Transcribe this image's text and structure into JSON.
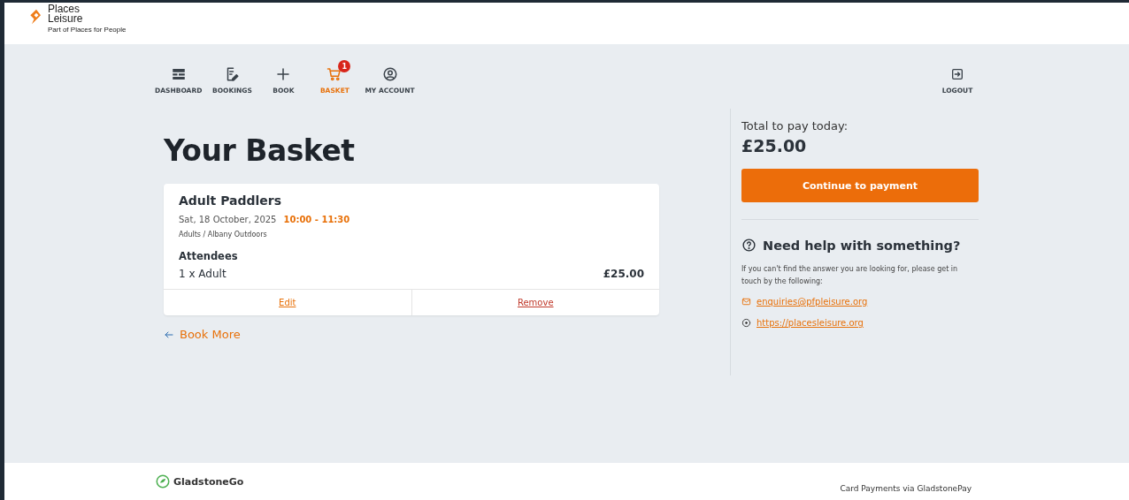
{
  "brand": {
    "name_line1": "Places",
    "name_line2": "Leisure",
    "tagline": "Part of Places for People"
  },
  "nav": [
    {
      "kind": "dashboard",
      "label": "DASHBOARD",
      "selected": false
    },
    {
      "kind": "bookings",
      "label": "BOOKINGS",
      "selected": false
    },
    {
      "kind": "book",
      "label": "BOOK",
      "selected": false
    },
    {
      "kind": "basket",
      "label": "BASKET",
      "selected": true,
      "badge": "1"
    },
    {
      "kind": "account",
      "label": "MY ACCOUNT",
      "selected": false
    }
  ],
  "logout": {
    "label": "LOGOUT"
  },
  "title": "Your Basket",
  "basket_items": [
    {
      "name": "Adult Paddlers",
      "date": "Sat, 18 October, 2025",
      "time": "10:00 - 11:30",
      "location": "Adults / Albany Outdoors",
      "attendees_heading": "Attendees",
      "attendees": [
        {
          "label": "1 x Adult",
          "price": "£25.00"
        }
      ],
      "actions": [
        "Edit",
        "Remove"
      ]
    }
  ],
  "book_more": "Book More",
  "summary": {
    "total_label": "Total to pay today:",
    "total": "£25.00",
    "pay_button": "Continue to payment"
  },
  "help": {
    "heading": "Need help with something?",
    "text": "If you can't find the answer you are looking for, please get in touch by the following:",
    "email": "enquiries@pfpleisure.org",
    "website": "https://placesleisure.org"
  },
  "footer": {
    "brand": "GladstoneGo",
    "payments": "Card Payments via GladstonePay"
  }
}
